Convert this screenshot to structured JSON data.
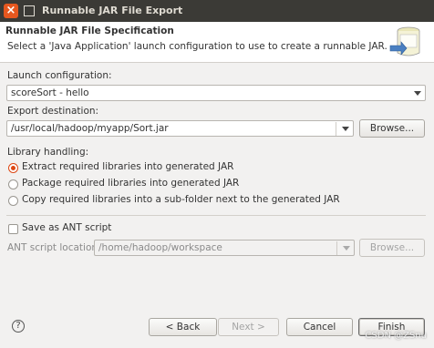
{
  "window": {
    "title": "Runnable JAR File Export"
  },
  "header": {
    "title": "Runnable JAR File Specification",
    "description": "Select a 'Java Application' launch configuration to use to create a runnable JAR."
  },
  "launch": {
    "label": "Launch configuration:",
    "value": "scoreSort - hello"
  },
  "export": {
    "label": "Export destination:",
    "value": "/usr/local/hadoop/myapp/Sort.jar",
    "browse": "Browse..."
  },
  "library": {
    "label": "Library handling:",
    "options": [
      {
        "label": "Extract required libraries into generated JAR",
        "selected": true
      },
      {
        "label": "Package required libraries into generated JAR",
        "selected": false
      },
      {
        "label": "Copy required libraries into a sub-folder next to the generated JAR",
        "selected": false
      }
    ]
  },
  "ant": {
    "checkbox_label": "Save as ANT script",
    "location_label": "ANT script location:",
    "location_value": "/home/hadoop/workspace",
    "browse": "Browse..."
  },
  "footer": {
    "back": "< Back",
    "next": "Next >",
    "cancel": "Cancel",
    "finish": "Finish"
  },
  "watermark": "CSDN @ZSnu",
  "colors": {
    "accent": "#dd4814",
    "titlebar": "#3b3a36"
  },
  "icons": [
    "close-icon",
    "maximize-icon",
    "help-icon",
    "jar-export-graphic"
  ]
}
